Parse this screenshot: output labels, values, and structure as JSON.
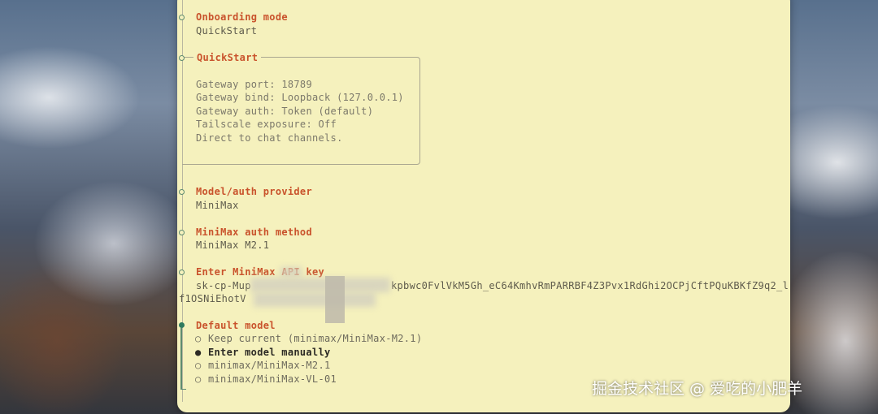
{
  "steps": {
    "onboarding": {
      "title": "Onboarding mode",
      "value": "QuickStart"
    },
    "quickstart": {
      "title": "QuickStart",
      "lines": [
        "Gateway port: 18789",
        "Gateway bind: Loopback (127.0.0.1)",
        "Gateway auth: Token (default)",
        "Tailscale exposure: Off",
        "Direct to chat channels."
      ]
    },
    "provider": {
      "title": "Model/auth provider",
      "value": "MiniMax"
    },
    "auth_method": {
      "title": "MiniMax auth method",
      "value": "MiniMax M2.1"
    },
    "api_key": {
      "title": "Enter MiniMax API key",
      "line1_start": "sk-cp-Mup",
      "line1_end": "kpbwc0FvlVkM5Gh_eC64KmhvRmPARRBF4Z3Pvx1RdGhi2OCPjCftPQuKBKfZ9q2_l",
      "line2_start": "f1OSNiEhotV"
    },
    "default_model": {
      "title": "Default model",
      "options": [
        {
          "marker": "○",
          "label": "Keep current (minimax/MiniMax-M2.1)"
        },
        {
          "marker": "●",
          "label": "Enter model manually"
        },
        {
          "marker": "○",
          "label": "minimax/MiniMax-M2.1"
        },
        {
          "marker": "○",
          "label": "minimax/MiniMax-VL-01"
        }
      ]
    }
  },
  "watermark": "掘金技术社区 @ 爱吃的小肥羊",
  "colors": {
    "panel": "#f5f1bd",
    "title": "#c9532c",
    "active_node": "#2f7a5e"
  }
}
